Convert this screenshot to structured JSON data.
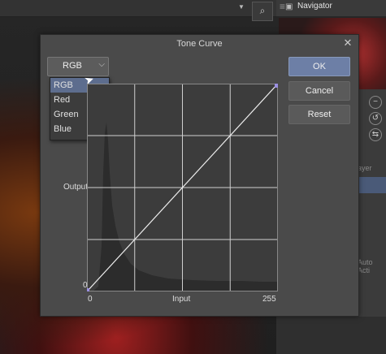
{
  "dialog": {
    "title": "Tone Curve",
    "close_glyph": "✕",
    "channel": {
      "selected": "RGB",
      "options": [
        "RGB",
        "Red",
        "Green",
        "Blue"
      ]
    },
    "buttons": {
      "ok": "OK",
      "cancel": "Cancel",
      "reset": "Reset"
    },
    "graph": {
      "output_label": "Output",
      "input_label": "Input",
      "min_label": "0",
      "max_label": "255",
      "y_min_label": "0"
    }
  },
  "navigator": {
    "tab": "Navigator"
  },
  "right_panel": {
    "label1": "ayer",
    "label2": "Auto Acti"
  },
  "colors": {
    "accent": "#6d7fa6",
    "selected_item": "#5d6d8e",
    "curve_handle": "#9a8fe0"
  }
}
